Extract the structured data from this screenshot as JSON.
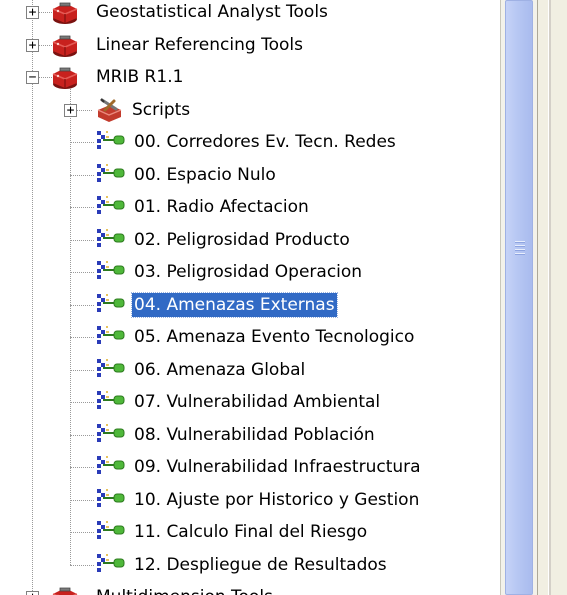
{
  "tree": {
    "items": [
      {
        "label": "Geostatistical Analyst Tools",
        "expander": "+",
        "icon": "toolbox-icon"
      },
      {
        "label": "Linear Referencing Tools",
        "expander": "+",
        "icon": "toolbox-icon"
      },
      {
        "label": "MRIB R1.1",
        "expander": "−",
        "icon": "toolbox-icon"
      },
      {
        "label": "Scripts",
        "expander": "+",
        "icon": "toolset-icon"
      },
      {
        "label": "00. Corredores Ev. Tecn. Redes",
        "icon": "script-tool-icon"
      },
      {
        "label": "00. Espacio Nulo",
        "icon": "script-tool-icon"
      },
      {
        "label": "01. Radio Afectacion",
        "icon": "script-tool-icon"
      },
      {
        "label": "02. Peligrosidad Producto",
        "icon": "script-tool-icon"
      },
      {
        "label": "03. Peligrosidad Operacion",
        "icon": "script-tool-icon"
      },
      {
        "label": "04. Amenazas Externas",
        "icon": "script-tool-icon",
        "selected": true
      },
      {
        "label": "05. Amenaza Evento Tecnologico",
        "icon": "script-tool-icon"
      },
      {
        "label": "06. Amenaza Global",
        "icon": "script-tool-icon"
      },
      {
        "label": "07. Vulnerabilidad Ambiental",
        "icon": "script-tool-icon"
      },
      {
        "label": "08. Vulnerabilidad Población",
        "icon": "script-tool-icon"
      },
      {
        "label": "09. Vulnerabilidad Infraestructura",
        "icon": "script-tool-icon"
      },
      {
        "label": "10. Ajuste por Historico y Gestion",
        "icon": "script-tool-icon"
      },
      {
        "label": "11. Calculo Final del Riesgo",
        "icon": "script-tool-icon"
      },
      {
        "label": "12. Despliegue de Resultados",
        "icon": "script-tool-icon"
      },
      {
        "label": "Multidimension Tools",
        "expander": "+",
        "icon": "toolbox-icon"
      }
    ]
  },
  "colors": {
    "selection_bg": "#316ac5",
    "selection_text": "#ffffff",
    "toolbox_red": "#c8211e",
    "script_blue": "#2a3bb8",
    "script_green": "#3c9a2a"
  }
}
